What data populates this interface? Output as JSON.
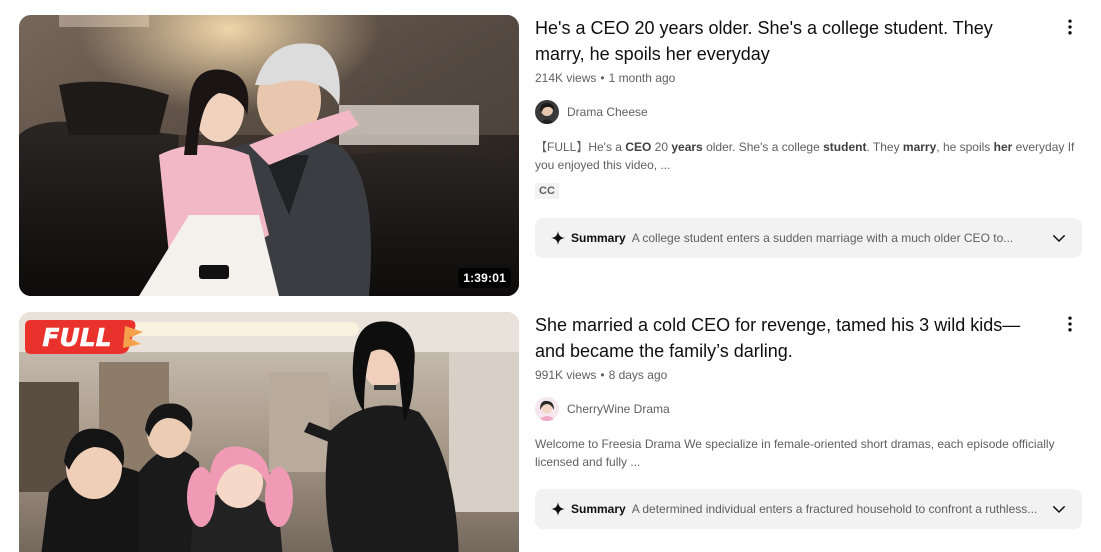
{
  "results": [
    {
      "title": "He's a CEO 20 years older. She's a college student. They marry, he spoils her everyday",
      "views": "214K views",
      "age": "1 month ago",
      "channel": "Drama Cheese",
      "snippet_parts": [
        "【FULL】He's a ",
        "CEO",
        " 20 ",
        "years",
        " older. She's a college ",
        "student",
        ". They ",
        "marry",
        ", he spoils ",
        "her",
        " everyday If you enjoyed this video, ..."
      ],
      "badge": "CC",
      "duration": "1:39:01",
      "summary_label": "Summary",
      "summary_text": "A college student enters a sudden marriage with a much older CEO to..."
    },
    {
      "title": "She married a cold CEO for revenge, tamed his 3 wild kids—and became the family’s darling.",
      "views": "991K views",
      "age": "8 days ago",
      "channel": "CherryWine Drama",
      "snippet": "Welcome to Freesia Drama We specialize in female-oriented short dramas, each episode officially licensed and fully ...",
      "thumb_badge": "FULL",
      "summary_label": "Summary",
      "summary_text": "A determined individual enters a fractured household to confront a ruthless..."
    }
  ],
  "colors": {
    "text_primary": "#0f0f0f",
    "text_secondary": "#606060",
    "summary_bg": "#f2f2f2",
    "badge_red": "#e8322b"
  },
  "icons": {
    "more": "vertical-ellipsis-icon",
    "sparkle": "sparkle-icon",
    "expand": "chevron-down-icon"
  }
}
